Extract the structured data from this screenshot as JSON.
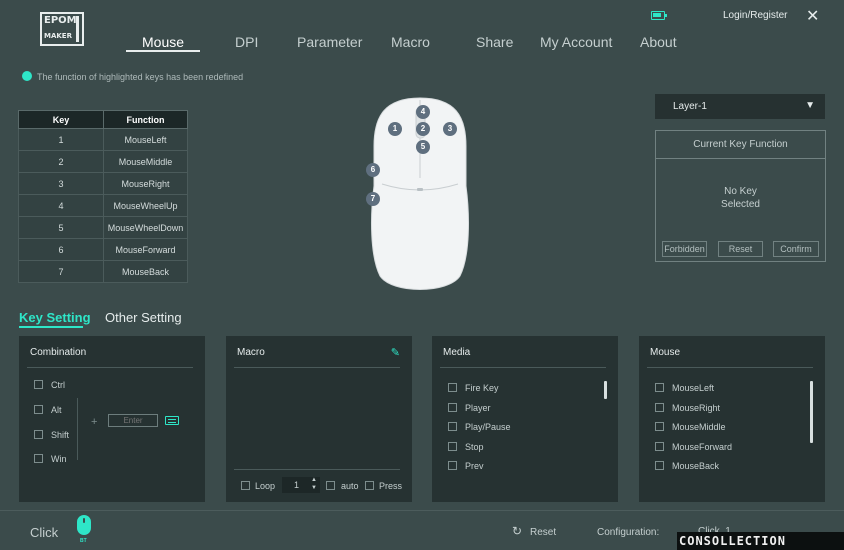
{
  "brand": {
    "line1": "EPOM",
    "line2": "MAKER"
  },
  "nav": {
    "items": [
      {
        "label": "Mouse",
        "active": true
      },
      {
        "label": "DPI"
      },
      {
        "label": "Parameter"
      },
      {
        "label": "Macro"
      },
      {
        "label": "Share"
      },
      {
        "label": "My Account"
      },
      {
        "label": "About"
      }
    ]
  },
  "header": {
    "login": "Login/Register",
    "close_icon": "close-icon",
    "battery_icon": "battery-icon"
  },
  "notice": "The function of highlighted keys has been redefined",
  "key_table": {
    "headers": [
      "Key",
      "Function"
    ],
    "rows": [
      [
        "1",
        "MouseLeft"
      ],
      [
        "2",
        "MouseMiddle"
      ],
      [
        "3",
        "MouseRight"
      ],
      [
        "4",
        "MouseWheelUp"
      ],
      [
        "5",
        "MouseWheelDown"
      ],
      [
        "6",
        "MouseForward"
      ],
      [
        "7",
        "MouseBack"
      ]
    ]
  },
  "mouse_badges": [
    "1",
    "2",
    "3",
    "4",
    "5",
    "6",
    "7"
  ],
  "layer": {
    "selected": "Layer-1",
    "arrow": "▼"
  },
  "current_key": {
    "title": "Current Key Function",
    "line1": "No Key",
    "line2": "Selected",
    "buttons": [
      "Forbidden",
      "Reset",
      "Confirm"
    ]
  },
  "tabs": {
    "key_setting": "Key Setting",
    "other_setting": "Other Setting"
  },
  "panels": {
    "combination": {
      "title": "Combination",
      "items": [
        "Ctrl",
        "Alt",
        "Shift",
        "Win"
      ],
      "plus": "+",
      "enter_placeholder": "Enter"
    },
    "macro": {
      "title": "Macro",
      "loop": "Loop",
      "count": "1",
      "auto": "auto",
      "press": "Press"
    },
    "media": {
      "title": "Media",
      "items": [
        "Fire Key",
        "Player",
        "Play/Pause",
        "Stop",
        "Prev"
      ]
    },
    "mouse": {
      "title": "Mouse",
      "items": [
        "MouseLeft",
        "MouseRight",
        "MouseMiddle",
        "MouseForward",
        "MouseBack"
      ]
    }
  },
  "footer": {
    "click": "Click",
    "bt": "BT",
    "reset": "Reset",
    "configuration": "Configuration:",
    "config_value": "Click_1",
    "watermark": "CONSOLLECTION"
  },
  "colors": {
    "accent": "#2ee6c8",
    "background": "#3b4b4b",
    "panel": "#263232"
  }
}
